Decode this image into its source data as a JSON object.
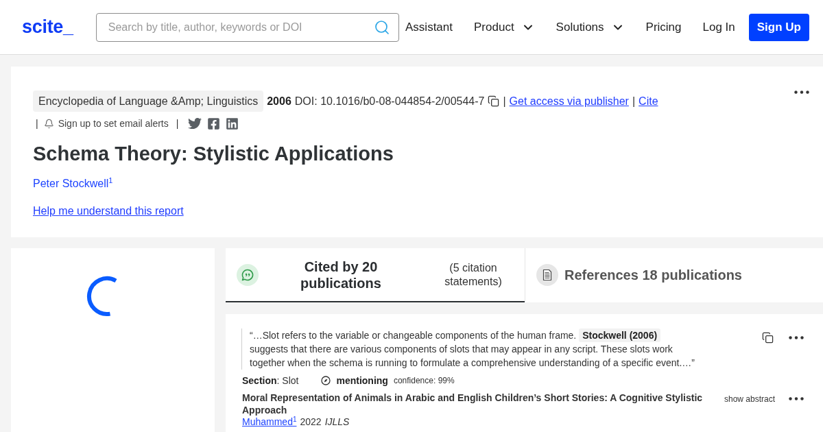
{
  "header": {
    "logo": "scite_",
    "search": {
      "placeholder": "Search by title, author, keywords or DOI"
    },
    "nav": [
      {
        "kind": "link",
        "label": "Assistant"
      },
      {
        "kind": "menu",
        "label": "Product"
      },
      {
        "kind": "menu",
        "label": "Solutions"
      },
      {
        "kind": "link",
        "label": "Pricing"
      },
      {
        "kind": "link",
        "label": "Log In"
      },
      {
        "kind": "button",
        "label": "Sign Up"
      }
    ]
  },
  "article": {
    "meta": [
      {
        "kind": "chip",
        "text": "Encyclopedia of Language &Amp; Linguistics"
      },
      {
        "kind": "year",
        "text": "2006"
      },
      {
        "kind": "doi",
        "text": "DOI: 10.1016/b0-08-044854-2/00544-7"
      },
      {
        "kind": "copy"
      },
      {
        "kind": "separator",
        "text": "|"
      },
      {
        "kind": "link",
        "text": "Get access via publisher"
      },
      {
        "kind": "separator",
        "text": "|"
      },
      {
        "kind": "link",
        "text": "Cite"
      }
    ],
    "alerts": {
      "lead": "|",
      "label": "Sign up to set email alerts",
      "trail": "|"
    },
    "title": "Schema Theory: Stylistic Applications",
    "author": "Peter Stockwell$^{1}$",
    "help_link": "Help me understand this report"
  },
  "tabs": [
    {
      "kind": "citing",
      "title": "Cited by 20 publications",
      "note": "(5 citation statements)",
      "selected": true
    },
    {
      "kind": "references",
      "title": "References 18 publications",
      "selected": false
    }
  ],
  "citations": [
    {
      "quote": "“…Slot refers to the variable or changeable components of the human frame. **Stockwell (2006)** suggests that there are various components of slots that may appear in any script. These slots work together when the schema is running to formulate a comprehensive understanding of a specific event.…”",
      "section": "**Section**: Slot",
      "type": "mentioning",
      "confidence": "confidence: 99%",
      "publication": {
        "title": "Moral Representation of Animals in Arabic and English Children’s Short Stories: A Cognitive Stylistic Approach",
        "show_abstract": "show abstract",
        "authors": "Muhammed$^{1}$",
        "year": "2022",
        "journal": "IJLLS"
      }
    }
  ]
}
